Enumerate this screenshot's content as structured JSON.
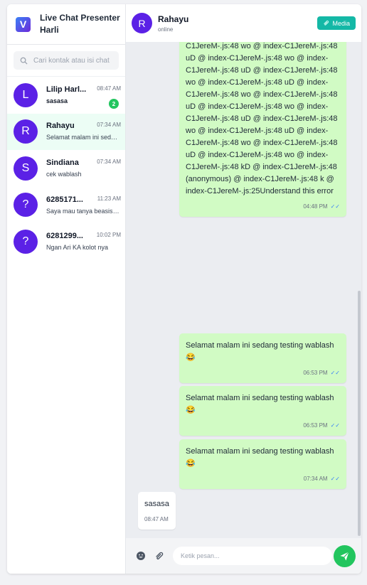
{
  "app": {
    "title": "Live Chat Presenter Harli",
    "logo_letter": "V"
  },
  "search": {
    "placeholder": "Cari kontak atau isi chat"
  },
  "contacts": [
    {
      "initial": "L",
      "name": "Lilip Harl...",
      "time": "08:47 AM",
      "message": "sasasa",
      "unread": "2"
    },
    {
      "initial": "R",
      "name": "Rahayu",
      "time": "07:34 AM",
      "message": "Selamat malam ini sedang testing wablash 😂"
    },
    {
      "initial": "S",
      "name": "Sindiana",
      "time": "07:34 AM",
      "message": "cek wablash"
    },
    {
      "initial": "?",
      "name": "6285171...",
      "time": "11:23 AM",
      "message": "Saya mau tanya beasiswa"
    },
    {
      "initial": "?",
      "name": "6281299...",
      "time": "10:02 PM",
      "message": "Ngan Ari KA kolot nya"
    }
  ],
  "chat": {
    "contact_initial": "R",
    "contact_name": "Rahayu",
    "status": "online",
    "media_label": "Media"
  },
  "messages": [
    {
      "text": "C1JereM-.js:48 wo @ index-C1JereM-.js:48 uD @ index-C1JereM-.js:48 wo @ index-C1JereM-.js:48 uD @ index-C1JereM-.js:48 wo @ index-C1JereM-.js:48 uD @ index-C1JereM-.js:48 wo @ index-C1JereM-.js:48 uD @ index-C1JereM-.js:48 wo @ index-C1JereM-.js:48 uD @ index-C1JereM-.js:48 wo @ index-C1JereM-.js:48 uD @ index-C1JereM-.js:48 wo @ index-C1JereM-.js:48 uD @ index-C1JereM-.js:48 wo @ index-C1JereM-.js:48 kD @ index-C1JereM-.js:48 (anonymous) @ index-C1JereM-.js:48 k @ index-C1JereM-.js:25Understand this error",
      "time": "04:48 PM",
      "ticks": "✓✓"
    },
    {
      "text": "Selamat malam ini sedang testing wablash 😂",
      "time": "06:53 PM",
      "ticks": "✓✓"
    },
    {
      "text": "Selamat malam ini sedang testing wablash 😂",
      "time": "06:53 PM",
      "ticks": "✓✓"
    },
    {
      "text": "Selamat malam ini sedang testing wablash 😂",
      "time": "07:34 AM",
      "ticks": "✓✓"
    },
    {
      "text": "sasasa",
      "time": "08:47 AM"
    }
  ],
  "composer": {
    "placeholder": "Ketik pesan..."
  },
  "icons": {
    "search": "search-icon",
    "media": "paperclip-icon",
    "emoji": "emoji-icon",
    "attach": "paperclip-icon",
    "send": "send-icon"
  },
  "colors": {
    "accent": "#5b21e6",
    "outgoing_bubble": "#d1fbc4",
    "send_button": "#22c55e",
    "media_button": "#14b8a6",
    "unread_badge": "#22c55e"
  }
}
